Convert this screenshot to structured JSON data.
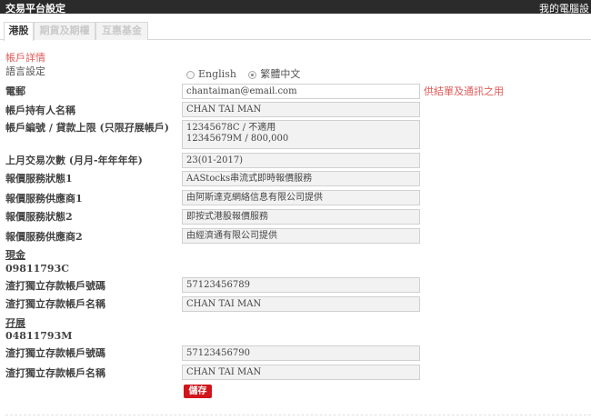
{
  "topbar": {
    "title": "交易平台設定",
    "right_text": "我的電腦設"
  },
  "tabs": [
    {
      "label": "港股",
      "active": true
    },
    {
      "label": "期貨及期權",
      "active": false
    },
    {
      "label": "互惠基金",
      "active": false
    }
  ],
  "account": {
    "section_title": "帳戶詳情",
    "language": {
      "label": "語言設定",
      "options": [
        "English",
        "繁體中文"
      ],
      "selected": "繁體中文"
    },
    "email": {
      "label": "電郵",
      "value": "chantaiman@email.com",
      "hint": "供結單及通訊之用"
    },
    "holder": {
      "label": "帳戶持有人名稱",
      "value": "CHAN TAI MAN"
    },
    "account_no": {
      "label": "帳戶編號 / 貸款上限 (只限孖展帳戶)",
      "lines": [
        "12345678C / 不適用",
        "12345679M / 800,000"
      ]
    },
    "last_trade": {
      "label": "上月交易次數 (月月-年年年年)",
      "value": "23(01-2017)"
    },
    "quote_status_1": {
      "label": "報價服務狀態1",
      "value": "AAStocks串流式即時報價服務"
    },
    "quote_provider_1": {
      "label": "報價服務供應商1",
      "value": "由阿斯達克網絡信息有限公司提供"
    },
    "quote_status_2": {
      "label": "報價服務狀態2",
      "value": "即按式港股報價服務"
    },
    "quote_provider_2": {
      "label": "報價服務供應商2",
      "value": "由經濟通有限公司提供"
    }
  },
  "cash": {
    "title": "現金",
    "account": "09811793C",
    "bank_no_label": "渣打獨立存款帳戶號碼",
    "bank_no": "57123456789",
    "bank_name_label": "渣打獨立存款帳戶名稱",
    "bank_name": "CHAN TAI MAN"
  },
  "margin": {
    "title": "孖展",
    "account": "04811793M",
    "bank_no_label": "渣打獨立存款帳戶號碼",
    "bank_no": "57123456790",
    "bank_name_label": "渣打獨立存款帳戶名稱",
    "bank_name": "CHAN TAI MAN"
  },
  "save_label": "儲存"
}
